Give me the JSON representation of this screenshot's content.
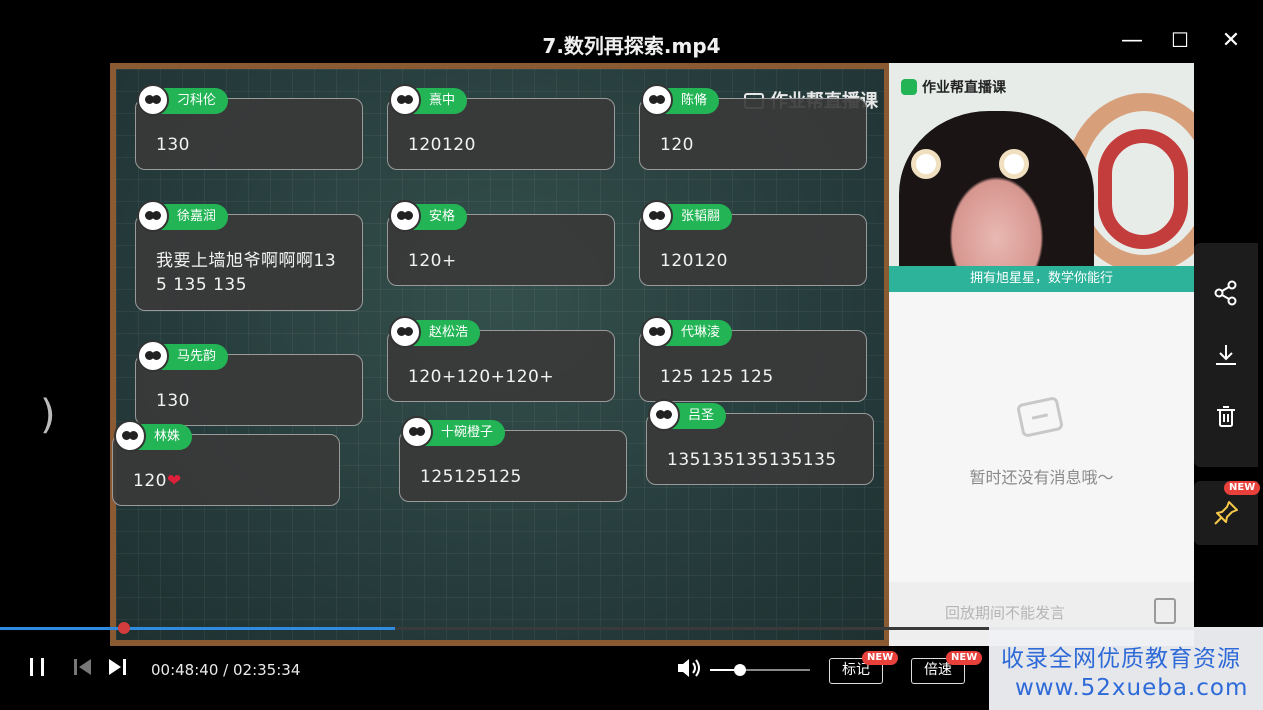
{
  "window": {
    "title": "7.数列再探索.mp4",
    "minimize": "—",
    "maximize": "☐",
    "close": "✕"
  },
  "board": {
    "logo_text": "作业帮直播课",
    "messages": [
      {
        "user": "刁科伦",
        "text": "130"
      },
      {
        "user": "熹中",
        "text": "120120"
      },
      {
        "user": "陈脩",
        "text": "120"
      },
      {
        "user": "徐嘉润",
        "text": "我要上墙旭爷啊啊啊135 135 135"
      },
      {
        "user": "安格",
        "text": "120+"
      },
      {
        "user": "张韬翮",
        "text": "120120"
      },
      {
        "user": "赵松浩",
        "text": "120+120+120+"
      },
      {
        "user": "代琳淩",
        "text": "125 125 125"
      },
      {
        "user": "马先韵",
        "text": "130"
      },
      {
        "user": "吕圣",
        "text": "135135135135135"
      },
      {
        "user": "林姝",
        "text": "120",
        "suffix": "❤"
      },
      {
        "user": "十碗橙子",
        "text": "125125125"
      }
    ]
  },
  "video": {
    "brand": "作业帮直播课",
    "caption": "拥有旭星星，数学你能行"
  },
  "chat": {
    "empty_text": "暂时还没有消息哦～",
    "disabled_tip": "回放期间不能发言"
  },
  "side_tools": {
    "share_icon": "share-icon",
    "download_icon": "download-icon",
    "delete_icon": "trash-icon",
    "pin_badge": "NEW"
  },
  "player": {
    "current_time": "00:48:40",
    "separator": "/",
    "total_time": "02:35:34",
    "progress": 0.313,
    "volume": 0.3,
    "mark_label": "标记",
    "mark_badge": "NEW",
    "speed_label": "倍速",
    "speed_badge": "NEW"
  },
  "watermark": {
    "line1": "收录全网优质教育资源",
    "line2": "www.52xueba.com"
  }
}
